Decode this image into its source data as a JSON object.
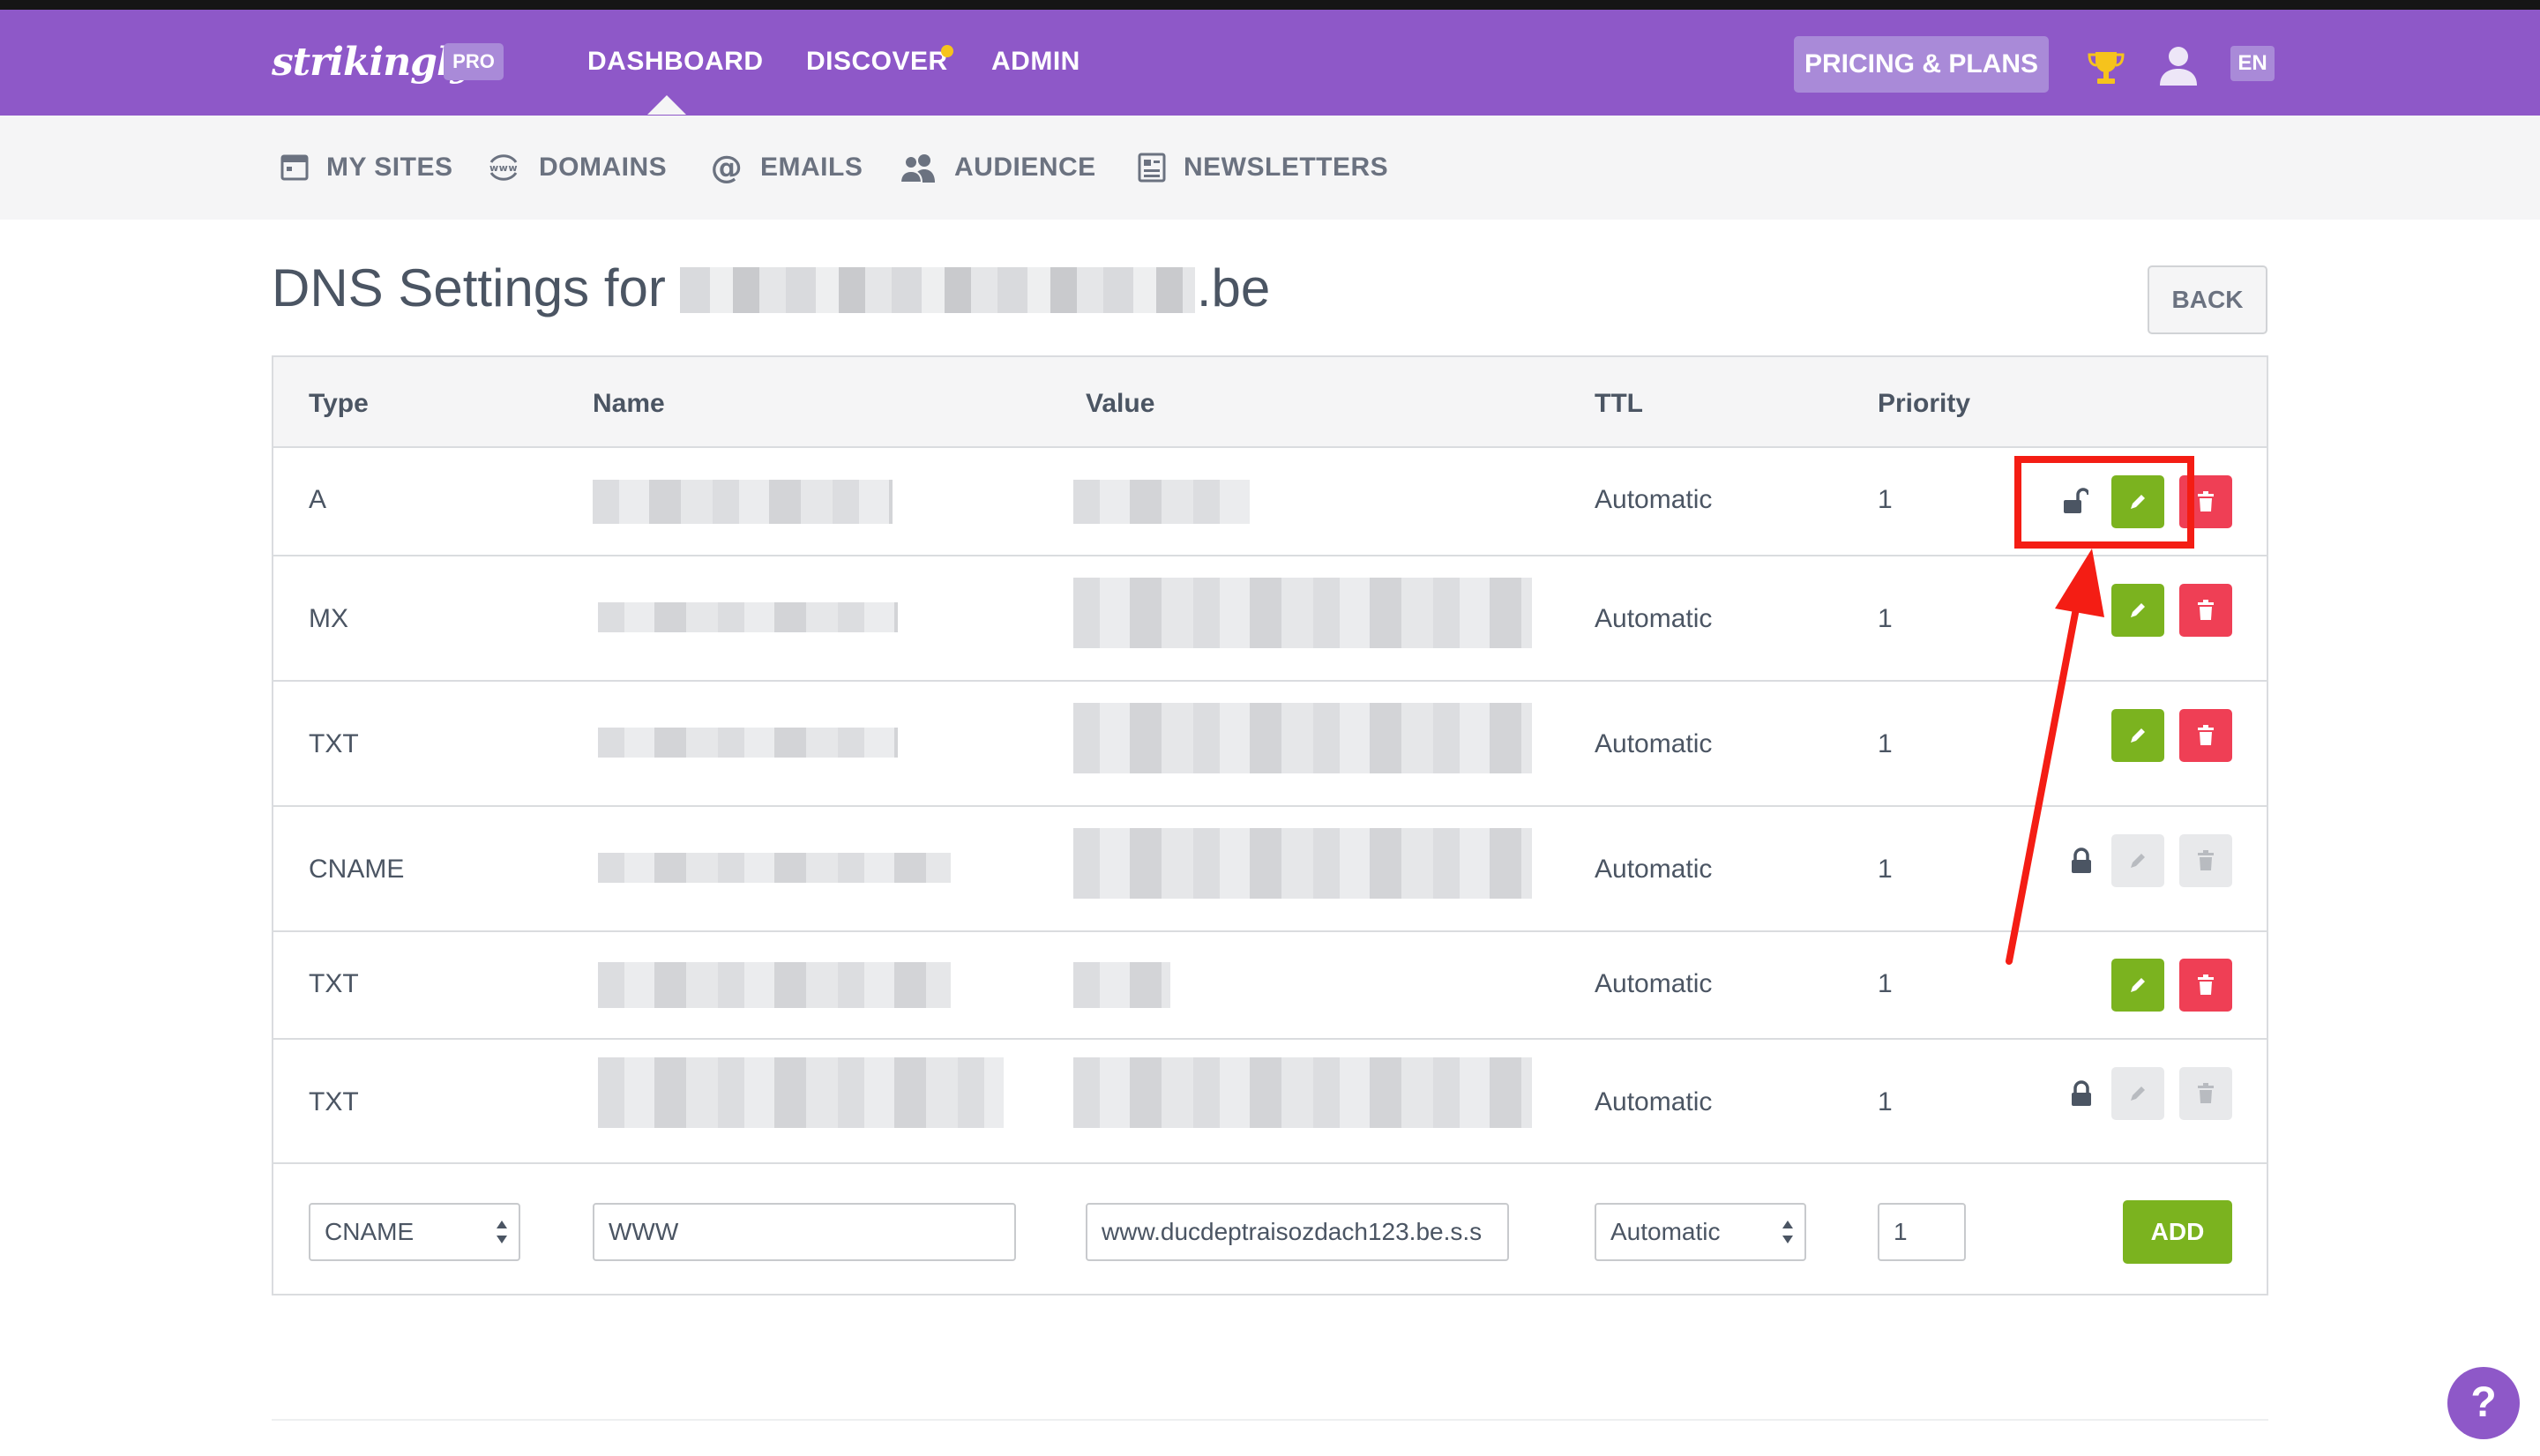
{
  "app": {
    "logo": "strikingly",
    "plan_badge": "PRO"
  },
  "topnav": {
    "items": [
      {
        "label": "DASHBOARD"
      },
      {
        "label": "DISCOVER"
      },
      {
        "label": "ADMIN"
      }
    ],
    "active": "DASHBOARD",
    "pricing_label": "PRICING & PLANS",
    "language": "EN"
  },
  "subnav": {
    "items": [
      {
        "label": "MY SITES",
        "icon": "calendar-icon"
      },
      {
        "label": "DOMAINS",
        "icon": "www-globe-icon"
      },
      {
        "label": "EMAILS",
        "icon": "at-sign-icon"
      },
      {
        "label": "AUDIENCE",
        "icon": "users-icon"
      },
      {
        "label": "NEWSLETTERS",
        "icon": "newsletter-icon"
      }
    ]
  },
  "page": {
    "title_prefix": "DNS Settings for",
    "title_suffix": ".be",
    "back_label": "BACK"
  },
  "table": {
    "headers": [
      "Type",
      "Name",
      "Value",
      "TTL",
      "Priority"
    ],
    "rows": [
      {
        "type": "A",
        "ttl": "Automatic",
        "priority": "1",
        "locked": false,
        "lock_icon": "unlocked-icon"
      },
      {
        "type": "MX",
        "ttl": "Automatic",
        "priority": "1",
        "locked": false
      },
      {
        "type": "TXT",
        "ttl": "Automatic",
        "priority": "1",
        "locked": false
      },
      {
        "type": "CNAME",
        "ttl": "Automatic",
        "priority": "1",
        "locked": true,
        "lock_icon": "lock-icon"
      },
      {
        "type": "TXT",
        "ttl": "Automatic",
        "priority": "1",
        "locked": false
      },
      {
        "type": "TXT",
        "ttl": "Automatic",
        "priority": "1",
        "locked": true,
        "lock_icon": "lock-icon"
      }
    ]
  },
  "add_form": {
    "type_value": "CNAME",
    "name_value": "WWW",
    "value_value": "www.ducdeptraisozdach123.be.s.s",
    "ttl_value": "Automatic",
    "priority_value": "1",
    "add_label": "ADD"
  },
  "help_label": "?",
  "colors": {
    "brand_purple": "#8e58c8",
    "badge_purple": "#a98ad8",
    "edit_green": "#7bb31f",
    "delete_red": "#ef3f55",
    "annotation_red": "#f41d14",
    "trophy_gold": "#f6c31c"
  }
}
